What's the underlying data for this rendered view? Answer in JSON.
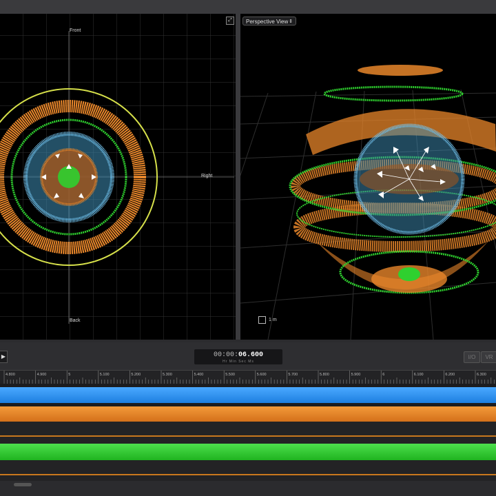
{
  "left_viewport": {
    "labels": {
      "front": "Front",
      "right": "Right",
      "back": "Back"
    },
    "expand_icon": "expand-icon"
  },
  "right_viewport": {
    "view_select": "Perspective View",
    "scale_label": "1 m"
  },
  "transport": {
    "play_icon": "play-icon",
    "timecode_prefix": "00:00:",
    "timecode_main": "06.600",
    "timecode_units": "Hr  Min  Sec  Ms",
    "mode_buttons": [
      "I/O",
      "VR"
    ]
  },
  "ruler": {
    "ticks": [
      "4.800",
      "4.900",
      "5",
      "5.100",
      "5.200",
      "5.300",
      "5.400",
      "5.500",
      "5.600",
      "5.700",
      "5.800",
      "5.900",
      "6",
      "6.100",
      "6.200",
      "6.300"
    ]
  },
  "tracks": [
    {
      "name": "blue",
      "color": "#2f8ff0"
    },
    {
      "name": "orange",
      "color": "#e8862a"
    },
    {
      "name": "green",
      "color": "#36c936"
    }
  ],
  "colors": {
    "orange": "#e8862a",
    "green": "#2fd02f",
    "blue": "#74c6f2",
    "yellow": "#d6e04a"
  }
}
